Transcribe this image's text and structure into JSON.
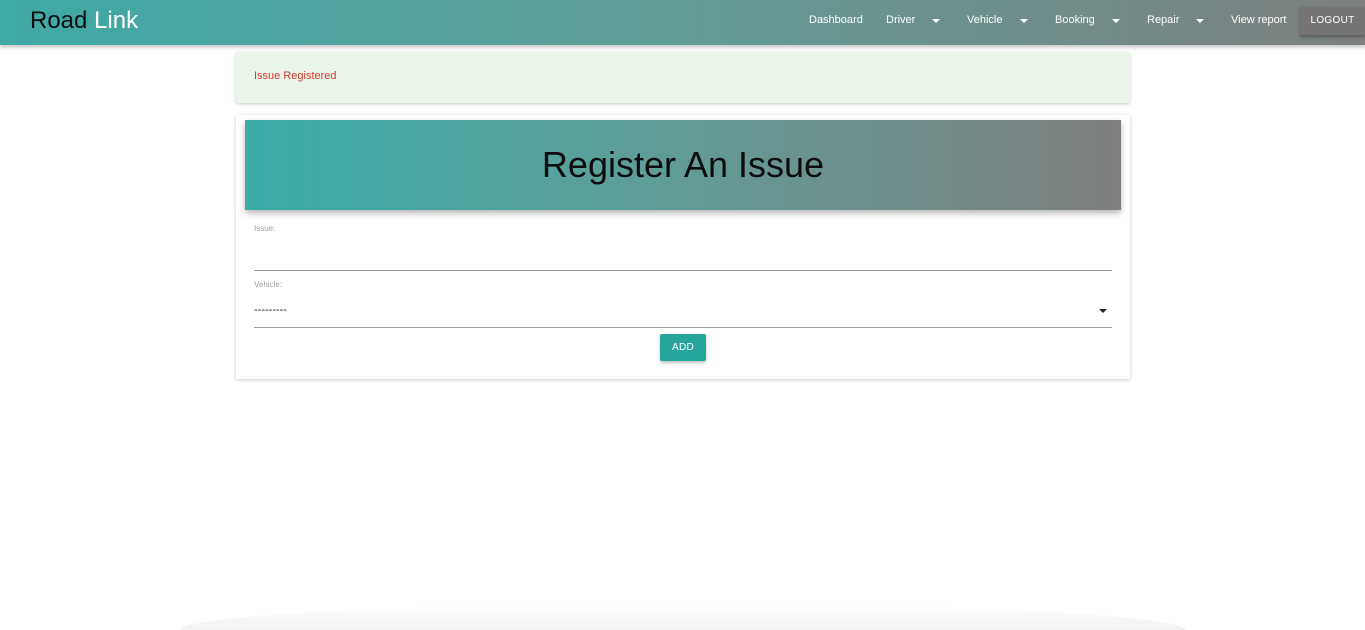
{
  "navbar": {
    "brand_part1": "Road",
    "brand_part2": "Link",
    "links": {
      "dashboard": "Dashboard",
      "driver": "Driver",
      "vehicle": "Vehicle",
      "booking": "Booking",
      "repair": "Repair",
      "view_report": "View report"
    },
    "logout_label": "LOGOUT"
  },
  "alert": {
    "message": "Issue Registered"
  },
  "form": {
    "title": "Register An Issue",
    "issue_label": "Issue:",
    "issue_value": "",
    "vehicle_label": "Vehicle:",
    "vehicle_selected": "---------",
    "add_label": "ADD"
  },
  "colors": {
    "accent": "#26a69a",
    "nav_gradient_start": "#3fa9a4",
    "nav_gradient_end": "#7d807f",
    "alert_background": "#e8f5e8",
    "alert_text": "#d33a2c",
    "logout_background": "#757575"
  },
  "icons": {
    "dropdown": "caret-down-icon"
  }
}
